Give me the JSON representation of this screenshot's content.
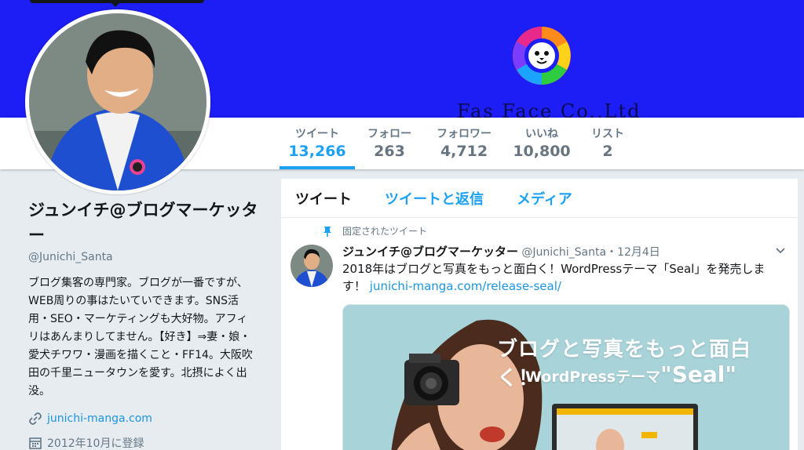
{
  "banner": {
    "brand_text": "Fas Face Co.,Ltd"
  },
  "nav": {
    "stats": [
      {
        "label": "ツイート",
        "value": "13,266"
      },
      {
        "label": "フォロー",
        "value": "263"
      },
      {
        "label": "フォロワー",
        "value": "4,712"
      },
      {
        "label": "いいね",
        "value": "10,800"
      },
      {
        "label": "リスト",
        "value": "2"
      }
    ]
  },
  "profile": {
    "name": "ジュンイチ@ブログマーケッター",
    "handle": "@Junichi_Santa",
    "bio": "ブログ集客の専門家。ブログが一番ですが、WEB周りの事はたいていできます。SNS活用・SEO・マーケティングも大好物。アフィリはあんまりしてません。【好き】⇒妻・娘・愛犬チワワ・漫画を描くこと・FF14。大阪吹田の千里ニュータウンを愛す。北摂によく出没。",
    "website": "junichi-manga.com",
    "joined": "2012年10月に登録",
    "link_icon": "link-icon",
    "calendar_icon": "calendar-icon"
  },
  "timeline": {
    "tabs": [
      {
        "label": "ツイート"
      },
      {
        "label": "ツイートと返信"
      },
      {
        "label": "メディア"
      }
    ],
    "pinned_label": "固定されたツイート",
    "tweet": {
      "name": "ジュンイチ@ブログマーケッター",
      "handle": "@Junichi_Santa",
      "separator": "・",
      "date": "12月4日",
      "text": "2018年はブログと写真をもっと面白く！WordPressテーマ「Seal」を発売しま す！",
      "link": "junichi-manga.com/release-seal/"
    },
    "media": {
      "headline": "ブログと写真をもっと面白く！",
      "subline_prefix": "WordPressテーマ",
      "subline_name": "\"Seal\""
    }
  },
  "colors": {
    "banner": "#1d1df5",
    "accent": "#1da1f2",
    "link": "#1b95e0",
    "text": "#14171a",
    "muted": "#657786",
    "page_bg": "#e6ecf0"
  }
}
